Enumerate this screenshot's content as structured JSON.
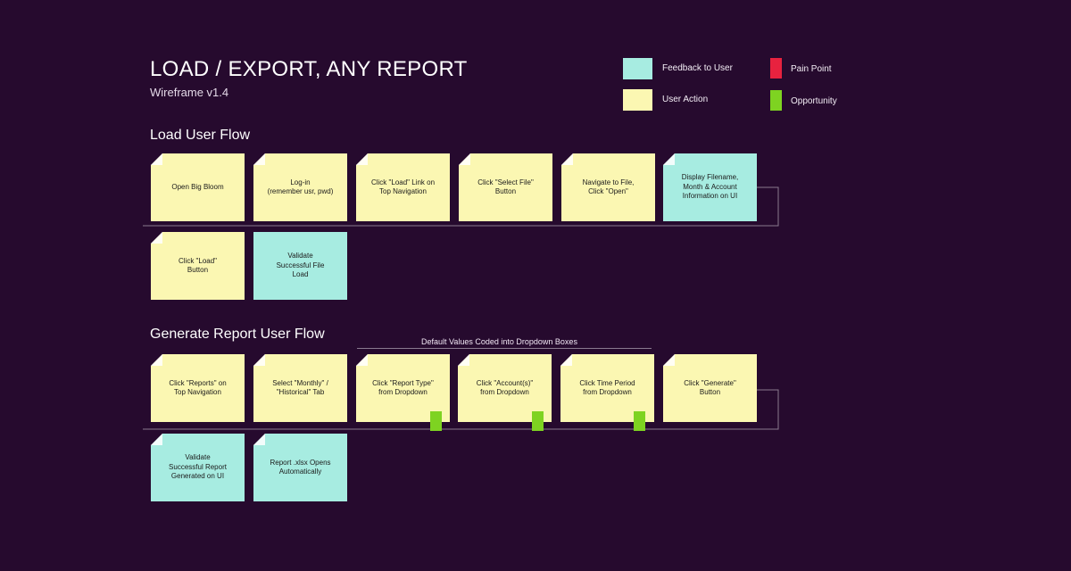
{
  "header": {
    "title": "LOAD / EXPORT, ANY REPORT",
    "subtitle": "Wireframe v1.4"
  },
  "legend": {
    "feedback": {
      "label": "Feedback to User",
      "color": "#a7ece1"
    },
    "action": {
      "label": "User Action",
      "color": "#fbf7b2"
    },
    "pain": {
      "label": "Pain Point",
      "color": "#e8223f"
    },
    "opportunity": {
      "label": "Opportunity",
      "color": "#7ed321"
    }
  },
  "load_flow": {
    "title": "Load User Flow",
    "steps": [
      {
        "text": "Open Big Bloom",
        "type": "action"
      },
      {
        "text": "Log-in\n(remember usr, pwd)",
        "type": "action"
      },
      {
        "text": "Click \"Load\" Link on\nTop Navigation",
        "type": "action"
      },
      {
        "text": "Click \"Select File\"\nButton",
        "type": "action"
      },
      {
        "text": "Navigate to File,\nClick \"Open\"",
        "type": "action"
      },
      {
        "text": "Display Filename,\nMonth & Account\nInformation on UI",
        "type": "feedback"
      },
      {
        "text": "Click \"Load\"\nButton",
        "type": "action"
      },
      {
        "text": "Validate\nSuccessful File\nLoad",
        "type": "feedback"
      }
    ]
  },
  "report_flow": {
    "title": "Generate Report User Flow",
    "annotation": "Default Values Coded into Dropdown Boxes",
    "steps": [
      {
        "text": "Click \"Reports\" on\nTop Navigation",
        "type": "action"
      },
      {
        "text": "Select \"Monthly\" /\n\"Historical\" Tab",
        "type": "action"
      },
      {
        "text": "Click \"Report Type\"\nfrom Dropdown",
        "type": "action",
        "marker": "opportunity"
      },
      {
        "text": "Click \"Account(s)\"\nfrom Dropdown",
        "type": "action",
        "marker": "opportunity"
      },
      {
        "text": "Click Time Period\nfrom Dropdown",
        "type": "action",
        "marker": "opportunity"
      },
      {
        "text": "Click \"Generate\"\nButton",
        "type": "action"
      },
      {
        "text": "Validate\nSuccessful Report\nGenerated on UI",
        "type": "feedback"
      },
      {
        "text": "Report .xlsx Opens\nAutomatically",
        "type": "feedback"
      }
    ]
  }
}
